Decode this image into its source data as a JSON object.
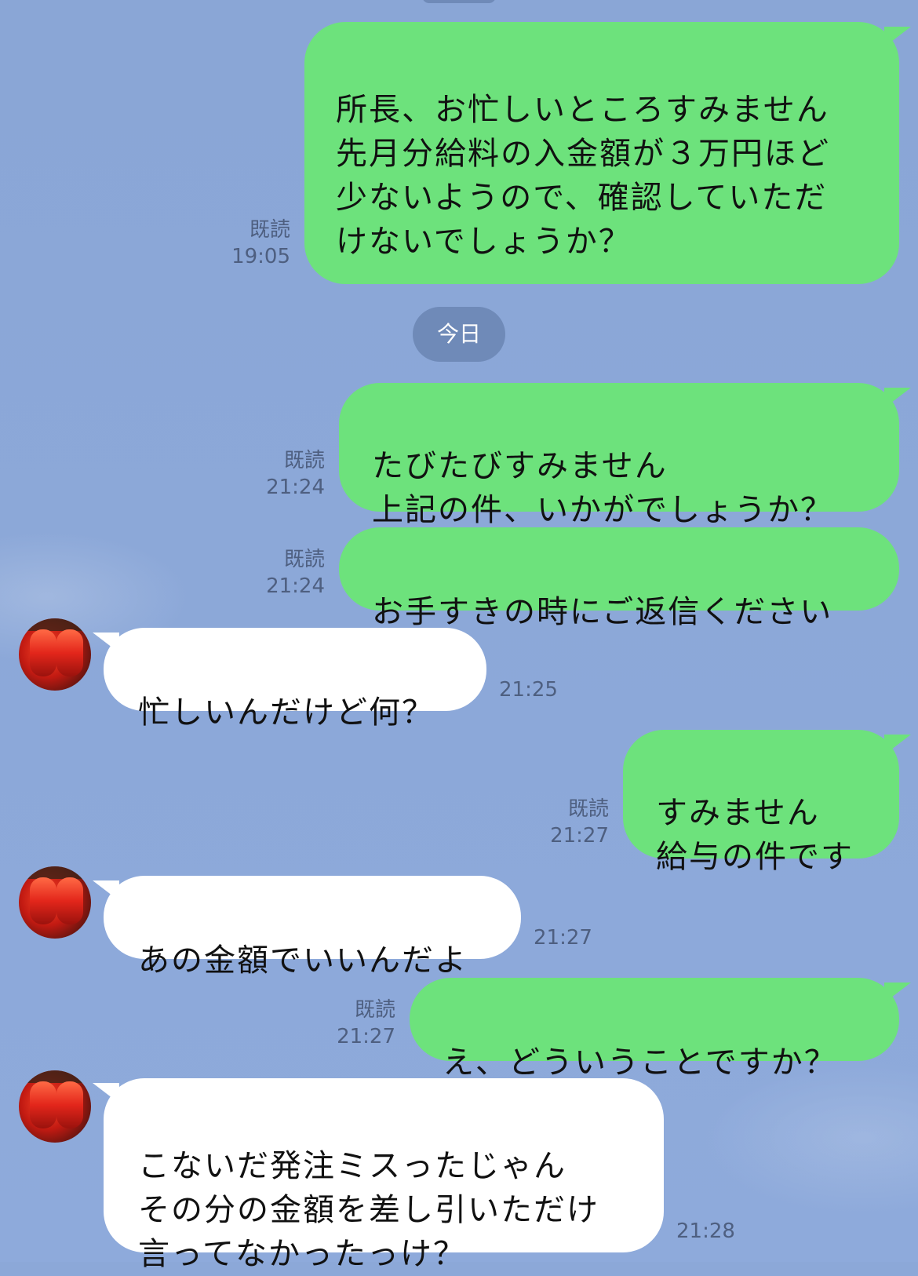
{
  "chat": {
    "date_chip": "今日",
    "messages": [
      {
        "id": "m1",
        "direction": "out",
        "text": "所長、お忙しいところすみません\n先月分給料の入金額が３万円ほど\n少ないようので、確認していただ\nけないでしょうか？",
        "read": "既読",
        "time": "19:05"
      },
      {
        "id": "m2",
        "direction": "out",
        "text": "たびたびすみません\n上記の件、いかがでしょうか？",
        "read": "既読",
        "time": "21:24"
      },
      {
        "id": "m3",
        "direction": "out",
        "text": "お手すきの時にご返信ください",
        "read": "既読",
        "time": "21:24"
      },
      {
        "id": "m4",
        "direction": "in",
        "text": "忙しいんだけど何？",
        "time": "21:25"
      },
      {
        "id": "m5",
        "direction": "out",
        "text": "すみません\n給与の件です",
        "read": "既読",
        "time": "21:27"
      },
      {
        "id": "m6",
        "direction": "in",
        "text": "あの金額でいいんだよ",
        "time": "21:27"
      },
      {
        "id": "m7",
        "direction": "out",
        "text": "え、どういうことですか？",
        "read": "既読",
        "time": "21:27"
      },
      {
        "id": "m8",
        "direction": "in",
        "text": "こないだ発注ミスったじゃん\nその分の金額を差し引いただけ\n言ってなかったっけ？",
        "time": "21:28"
      }
    ]
  },
  "colors": {
    "background": "#8ca8d8",
    "outgoing_bubble": "#6de27c",
    "incoming_bubble": "#ffffff",
    "date_chip": "#6f8ab8",
    "meta_text": "#4e5f80"
  },
  "icons": {
    "avatar": "red-lantern-avatar",
    "read_receipt": "read-receipt-text"
  }
}
